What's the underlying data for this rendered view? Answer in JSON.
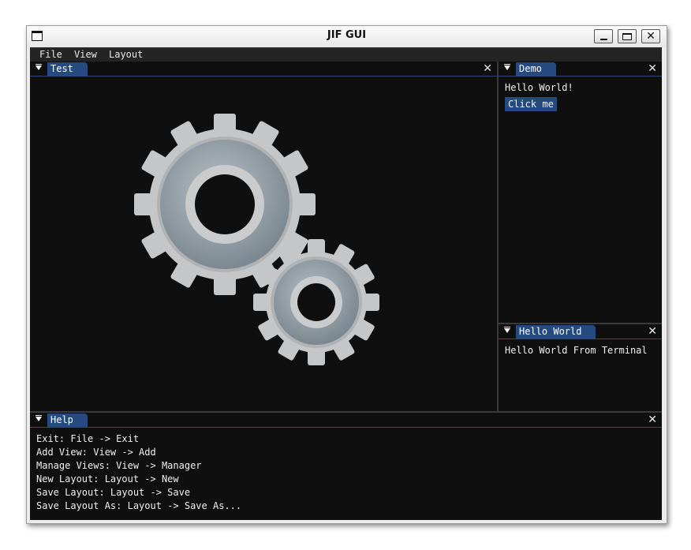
{
  "window": {
    "title": "JIF GUI",
    "close_glyph": "✕"
  },
  "menu": {
    "items": [
      "File",
      "View",
      "Layout"
    ]
  },
  "panels": {
    "test": {
      "tab": "Test",
      "close": "✕"
    },
    "demo": {
      "tab": "Demo",
      "close": "✕",
      "text": "Hello World!",
      "button": "Click me"
    },
    "hello": {
      "tab": "Hello World",
      "close": "✕",
      "text": "Hello World From Terminal"
    },
    "help": {
      "tab": "Help",
      "close": "✕",
      "lines": [
        "Exit: File -> Exit",
        "Add View: View -> Add",
        "Manage Views: View -> Manager",
        "New Layout: Layout -> New",
        "Save Layout: Layout -> Save",
        "Save Layout As: Layout -> Save As..."
      ]
    }
  },
  "colors": {
    "tab_active": "#254a80",
    "panel_bg": "#0f0f0f",
    "menubar_bg": "#242424",
    "gear_metal": "#c4c6c8",
    "gear_face": "#8c979f"
  },
  "icons": [
    "window-icon",
    "minimize-icon",
    "maximize-icon",
    "close-icon",
    "collapse-arrow-icon",
    "gears-image"
  ]
}
